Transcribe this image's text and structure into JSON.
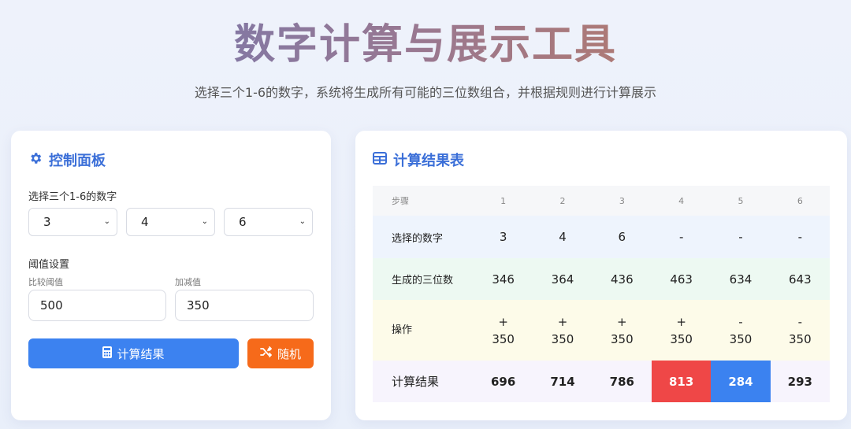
{
  "header": {
    "title": "数字计算与展示工具",
    "subtitle": "选择三个1-6的数字，系统将生成所有可能的三位数组合，并根据规则进行计算展示"
  },
  "control": {
    "title": "控制面板",
    "select_label": "选择三个1-6的数字",
    "selects": [
      "3",
      "4",
      "6"
    ],
    "threshold_label": "阈值设置",
    "compare_label": "比较阈值",
    "compare_value": "500",
    "addsub_label": "加减值",
    "addsub_value": "350",
    "calc_button": "计算结果",
    "random_button": "随机"
  },
  "results": {
    "title": "计算结果表",
    "headers": [
      "步骤",
      "1",
      "2",
      "3",
      "4",
      "5",
      "6"
    ],
    "rows": [
      {
        "label": "选择的数字",
        "cells": [
          "3",
          "4",
          "6",
          "-",
          "-",
          "-"
        ]
      },
      {
        "label": "生成的三位数",
        "cells": [
          "346",
          "364",
          "436",
          "463",
          "634",
          "643"
        ]
      },
      {
        "label": "操作",
        "ops": [
          "+",
          "+",
          "+",
          "+",
          "-",
          "-"
        ],
        "vals": [
          "350",
          "350",
          "350",
          "350",
          "350",
          "350"
        ]
      },
      {
        "label": "计算结果",
        "cells": [
          "696",
          "714",
          "786",
          "813",
          "284",
          "293"
        ]
      }
    ]
  },
  "colors": {
    "primary": "#3c82f0",
    "accent": "#f66a1a",
    "highlight_red": "#ef4747",
    "highlight_blue": "#3b82f0"
  }
}
